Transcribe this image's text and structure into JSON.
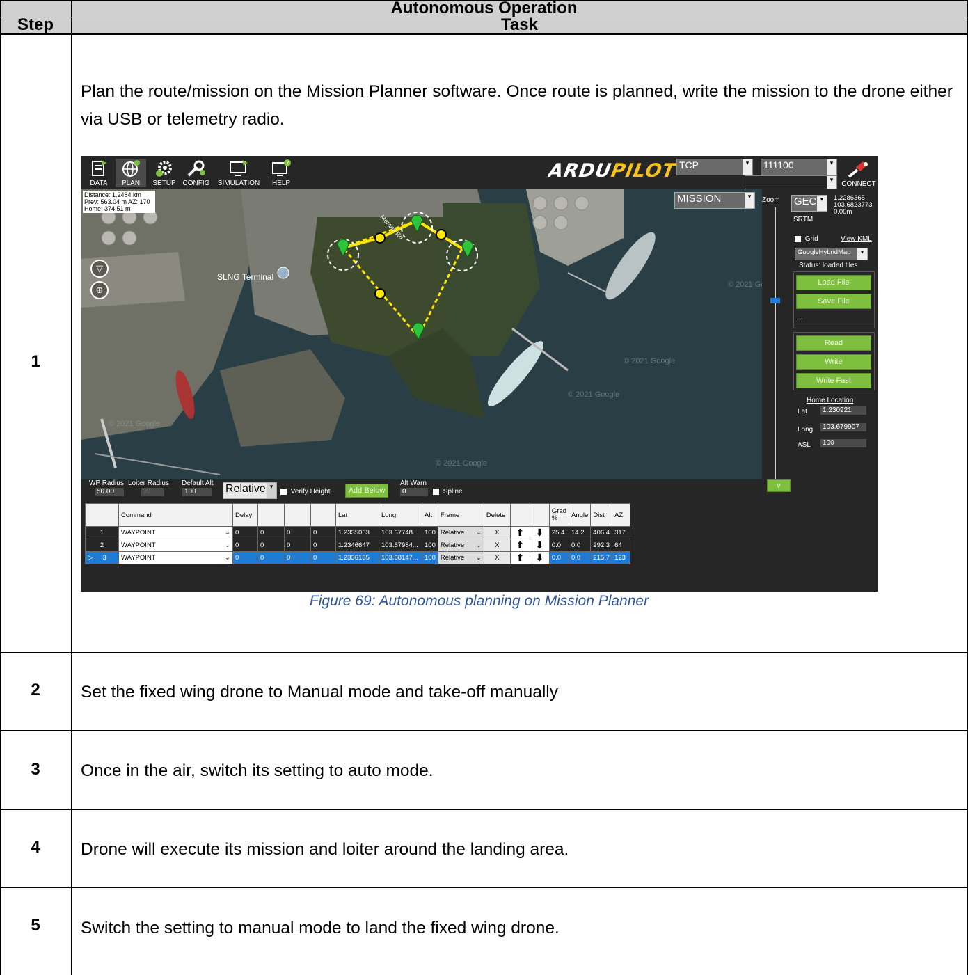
{
  "table": {
    "title": "Autonomous Operation",
    "col_step": "Step",
    "col_task": "Task"
  },
  "steps": [
    {
      "num": "1",
      "task": "Plan the route/mission on the Mission Planner software. Once route is planned, write the mission to the drone either via USB or telemetry radio."
    },
    {
      "num": "2",
      "task": "Set the fixed wing drone to Manual mode and take-off manually"
    },
    {
      "num": "3",
      "task": "Once in the air, switch its setting to auto mode."
    },
    {
      "num": "4",
      "task": "Drone will execute its mission and loiter around the landing area."
    },
    {
      "num": "5",
      "task": "Switch the setting to manual mode to land the fixed wing drone."
    }
  ],
  "figure_caption": "Figure 69: Autonomous planning on Mission Planner",
  "mp": {
    "menu": [
      "DATA",
      "PLAN",
      "SETUP",
      "CONFIG",
      "SIMULATION",
      "HELP"
    ],
    "logo": "ARDUPILOT",
    "conn_type": "TCP",
    "baud": "111100",
    "connect": "CONNECT",
    "map_info": [
      "Distance: 1.2484 km",
      "Prev: 563.04 m AZ: 170",
      "Home: 374.51 m"
    ],
    "map_label": "SLNG Terminal",
    "road_label": "Meranti Rd",
    "watermark": "© 2021 Google",
    "mode": "MISSION",
    "zoom": "Zoom",
    "coord_type": "GEC",
    "coords": [
      "1.2286365",
      "103.6823773",
      "0.00m"
    ],
    "srtm": "SRTM",
    "grid": "Grid",
    "view_kml": "View KML",
    "map_type": "GoogleHybridMap",
    "status": "Status: loaded tiles",
    "load_file": "Load File",
    "save_file": "Save File",
    "dots": "...",
    "read": "Read",
    "write": "Write",
    "write_fast": "Write Fast",
    "home_location": "Home Location",
    "home_lat_label": "Lat",
    "home_lat": "1.230921",
    "home_long_label": "Long",
    "home_long": "103.679907",
    "home_asl_label": "ASL",
    "home_asl": "100",
    "v_button": "v",
    "wp_radius_label": "WP Radius",
    "wp_radius": "50.00",
    "loiter_radius_label": "Loiter Radius",
    "loiter_radius": "30",
    "default_alt_label": "Default Alt",
    "default_alt": "100",
    "alt_frame": "Relative",
    "verify_height": "Verify Height",
    "add_below": "Add Below",
    "alt_warn_label": "Alt Warn",
    "alt_warn": "0",
    "spline": "Spline",
    "wp_headers": [
      "",
      "Command",
      "Delay",
      "",
      "",
      "",
      "Lat",
      "Long",
      "Alt",
      "Frame",
      "Delete",
      "",
      "",
      "Grad %",
      "Angle",
      "Dist",
      "AZ"
    ],
    "wp_rows": [
      {
        "n": "1",
        "cmd": "WAYPOINT",
        "delay": "0",
        "p2": "0",
        "p3": "0",
        "p4": "0",
        "lat": "1.2335063",
        "long": "103.67748...",
        "alt": "100",
        "frame": "Relative",
        "del": "X",
        "grad": "25.4",
        "angle": "14.2",
        "dist": "406.4",
        "az": "317"
      },
      {
        "n": "2",
        "cmd": "WAYPOINT",
        "delay": "0",
        "p2": "0",
        "p3": "0",
        "p4": "0",
        "lat": "1.2346647",
        "long": "103.67984...",
        "alt": "100",
        "frame": "Relative",
        "del": "X",
        "grad": "0.0",
        "angle": "0.0",
        "dist": "292.3",
        "az": "64"
      },
      {
        "n": "3",
        "cmd": "WAYPOINT",
        "delay": "0",
        "p2": "0",
        "p3": "0",
        "p4": "0",
        "lat": "1.2336135",
        "long": "103.68147...",
        "alt": "100",
        "frame": "Relative",
        "del": "X",
        "grad": "0.0",
        "angle": "0.0",
        "dist": "215.7",
        "az": "123"
      }
    ]
  }
}
